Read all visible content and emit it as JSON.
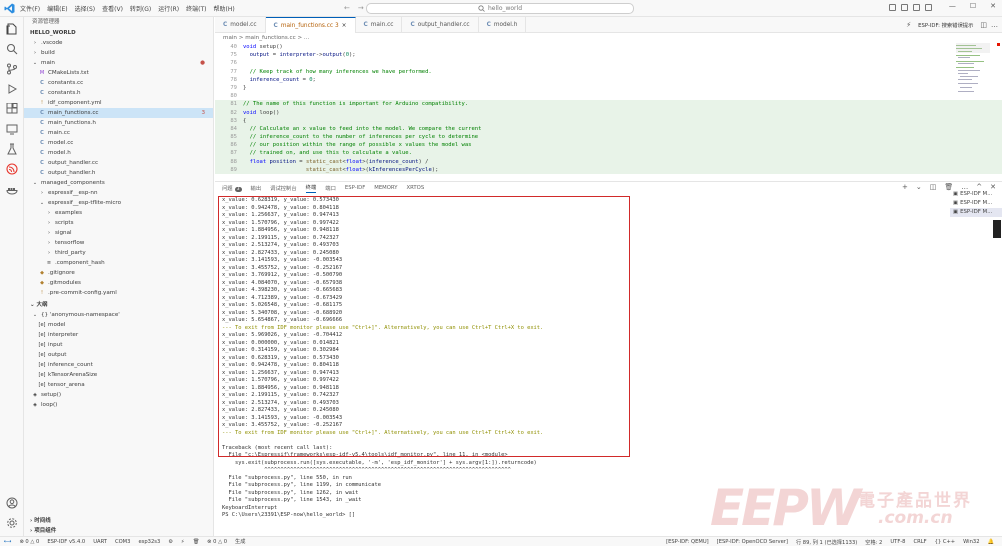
{
  "titlebar": {
    "menus": [
      "文件(F)",
      "编辑(E)",
      "选择(S)",
      "查看(V)",
      "转到(G)",
      "运行(R)",
      "终端(T)",
      "帮助(H)"
    ],
    "search_placeholder": "hello_world",
    "nav_back": "←",
    "nav_forward": "→"
  },
  "sidebar": {
    "header": "资源管理器",
    "root": "HELLO_WORLD",
    "tree": [
      {
        "label": ".vscode",
        "icon": "chevron-right",
        "indent": 1
      },
      {
        "label": "build",
        "icon": "chevron-right",
        "indent": 1
      },
      {
        "label": "main",
        "icon": "chevron-down",
        "indent": 1,
        "modified": true
      },
      {
        "label": "CMakeLists.txt",
        "icon": "M",
        "indent": 2
      },
      {
        "label": "constants.cc",
        "icon": "C",
        "indent": 2
      },
      {
        "label": "constants.h",
        "icon": "C",
        "indent": 2
      },
      {
        "label": "idf_component.yml",
        "icon": "!",
        "indent": 2
      },
      {
        "label": "main_functions.cc",
        "icon": "C",
        "indent": 2,
        "selected": true,
        "badge": "3"
      },
      {
        "label": "main_functions.h",
        "icon": "C",
        "indent": 2
      },
      {
        "label": "main.cc",
        "icon": "C",
        "indent": 2
      },
      {
        "label": "model.cc",
        "icon": "C",
        "indent": 2
      },
      {
        "label": "model.h",
        "icon": "C",
        "indent": 2
      },
      {
        "label": "output_handler.cc",
        "icon": "C",
        "indent": 2
      },
      {
        "label": "output_handler.h",
        "icon": "C",
        "indent": 2
      },
      {
        "label": "managed_components",
        "icon": "chevron-down",
        "indent": 1
      },
      {
        "label": "espressif__esp-nn",
        "icon": "chevron-right",
        "indent": 2
      },
      {
        "label": "espressif__esp-tflite-micro",
        "icon": "chevron-down",
        "indent": 2
      },
      {
        "label": "examples",
        "icon": "chevron-right",
        "indent": 3
      },
      {
        "label": "scripts",
        "icon": "chevron-right",
        "indent": 3
      },
      {
        "label": "signal",
        "icon": "chevron-right",
        "indent": 3
      },
      {
        "label": "tensorflow",
        "icon": "chevron-right",
        "indent": 3
      },
      {
        "label": "third_party",
        "icon": "chevron-right",
        "indent": 3
      },
      {
        "label": ".component_hash",
        "icon": "≡",
        "indent": 3
      },
      {
        "label": ".gitignore",
        "icon": "◆",
        "indent": 2
      },
      {
        "label": ".gitmodules",
        "icon": "◆",
        "indent": 2
      },
      {
        "label": ".pre-commit-config.yaml",
        "icon": "!",
        "indent": 2
      }
    ],
    "outline_header": "大纲",
    "outline": [
      {
        "label": "{} 'anonymous-namespace'",
        "icon": "chevron-down",
        "indent": 1
      },
      {
        "label": "model",
        "icon": "[e]",
        "indent": 2
      },
      {
        "label": "interpreter",
        "icon": "[e]",
        "indent": 2
      },
      {
        "label": "input",
        "icon": "[e]",
        "indent": 2
      },
      {
        "label": "output",
        "icon": "[e]",
        "indent": 2
      },
      {
        "label": "inference_count",
        "icon": "[e]",
        "indent": 2
      },
      {
        "label": "kTensorArenaSize",
        "icon": "[e]",
        "indent": 2
      },
      {
        "label": "tensor_arena",
        "icon": "[e]",
        "indent": 2
      },
      {
        "label": "setup()",
        "icon": "◈",
        "indent": 1
      },
      {
        "label": "loop()",
        "icon": "◈",
        "indent": 1
      }
    ],
    "timeline_header": "时间线",
    "project_header": "项目组件"
  },
  "editor": {
    "tabs": [
      {
        "label": "model.cc",
        "active": false
      },
      {
        "label": "main_functions.cc 3",
        "active": true
      },
      {
        "label": "main.cc",
        "active": false
      },
      {
        "label": "output_handler.cc",
        "active": false
      },
      {
        "label": "model.h",
        "active": false
      }
    ],
    "esp_button": "ESP-IDF: 搜索错误提示",
    "breadcrumb": "main > main_functions.cc > ...",
    "lines": [
      {
        "n": "40",
        "text": "void setup()"
      },
      {
        "n": "75",
        "text": "  output = interpreter->output(0);"
      },
      {
        "n": "76",
        "text": ""
      },
      {
        "n": "77",
        "text": "  // Keep track of how many inferences we have performed."
      },
      {
        "n": "78",
        "text": "  inference_count = 0;"
      },
      {
        "n": "79",
        "text": "}"
      },
      {
        "n": "80",
        "text": ""
      },
      {
        "n": "81",
        "text": "// The name of this function is important for Arduino compatibility."
      },
      {
        "n": "82",
        "text": "void loop()"
      },
      {
        "n": "83",
        "text": "{"
      },
      {
        "n": "84",
        "text": "  // Calculate an x value to feed into the model. We compare the current"
      },
      {
        "n": "85",
        "text": "  // inference_count to the number of inferences per cycle to determine"
      },
      {
        "n": "86",
        "text": "  // our position within the range of possible x values the model was"
      },
      {
        "n": "87",
        "text": "  // trained on, and use this to calculate a value."
      },
      {
        "n": "88",
        "text": "  float position = static_cast<float>(inference_count) /"
      },
      {
        "n": "89",
        "text": "                   static_cast<float>(kInferencesPerCycle);"
      }
    ]
  },
  "panel": {
    "tabs": [
      "问题",
      "输出",
      "调试控制台",
      "终端",
      "端口",
      "ESP-IDF",
      "MEMORY",
      "XRTOS"
    ],
    "problems_badge": "3",
    "terminal_list": [
      "ESP-IDF M...",
      "ESP-IDF M...",
      "ESP-IDF M..."
    ],
    "terminal_lines": [
      "x_value: 0.628319, y_value: 0.573430",
      "x_value: 0.942478, y_value: 0.804118",
      "x_value: 1.256637, y_value: 0.947413",
      "x_value: 1.570796, y_value: 0.997422",
      "x_value: 1.884956, y_value: 0.948118",
      "x_value: 2.199115, y_value: 0.742327",
      "x_value: 2.513274, y_value: 0.493703",
      "x_value: 2.827433, y_value: 0.245080",
      "x_value: 3.141593, y_value: -0.003543",
      "x_value: 3.455752, y_value: -0.252167",
      "x_value: 3.769912, y_value: -0.500790",
      "x_value: 4.084070, y_value: -0.657938",
      "x_value: 4.398230, y_value: -0.665683",
      "x_value: 4.712389, y_value: -0.673429",
      "x_value: 5.026548, y_value: -0.681175",
      "x_value: 5.340708, y_value: -0.688920",
      "x_value: 5.654867, y_value: -0.696666",
      "--- To exit from IDF monitor please use \"Ctrl+]\". Alternatively, you can use Ctrl+T Ctrl+X to exit.",
      "x_value: 5.969026, y_value: -0.704412",
      "x_value: 0.000000, y_value: 0.014821",
      "x_value: 0.314159, y_value: 0.302984",
      "x_value: 0.628319, y_value: 0.573430",
      "x_value: 0.942478, y_value: 0.804118",
      "x_value: 1.256637, y_value: 0.947413",
      "x_value: 1.570796, y_value: 0.997422",
      "x_value: 1.884956, y_value: 0.948118",
      "x_value: 2.199115, y_value: 0.742327",
      "x_value: 2.513274, y_value: 0.493703",
      "x_value: 2.827433, y_value: 0.245080",
      "x_value: 3.141593, y_value: -0.003543",
      "x_value: 3.455752, y_value: -0.252167",
      "--- To exit from IDF monitor please use \"Ctrl+]\". Alternatively, you can use Ctrl+T Ctrl+X to exit.",
      "",
      "Traceback (most recent call last):",
      "  File \"c:\\Espressif\\frameworks\\esp-idf-v5.4\\tools\\idf_monitor.py\", line 11, in <module>",
      "    sys.exit(subprocess.run([sys.executable, '-m', 'esp_idf_monitor'] + sys.argv[1:]).returncode)",
      "             ^^^^^^^^^^^^^^^^^^^^^^^^^^^^^^^^^^^^^^^^^^^^^^^^^^^^^^^^^^^^^^^^^^^^^^^^^^^^",
      "  File \"subprocess.py\", line 550, in run",
      "  File \"subprocess.py\", line 1199, in communicate",
      "  File \"subprocess.py\", line 1262, in wait",
      "  File \"subprocess.py\", line 1543, in _wait",
      "KeyboardInterrupt",
      "PS C:\\Users\\23391\\ESP-now\\hello_world> []"
    ]
  },
  "statusbar": {
    "left": [
      "⊗ 0 △ 0",
      "ESP-IDF v5.4.0",
      "UART",
      "COM3",
      "esp32s3",
      "⚙",
      "⚡",
      "🗑",
      "⊗ 0 △ 0",
      "生成"
    ],
    "right": [
      "[ESP-IDF: QEMU]",
      "[ESP-IDF: OpenOCD Server]",
      "行 89, 列 1 (已选择1133)",
      "空格: 2",
      "UTF-8",
      "CRLF",
      "{} C++",
      "Win32"
    ]
  },
  "watermark": {
    "brand": "EEPW",
    "cn": "電子產品世界",
    "domain": ".com.cn"
  }
}
